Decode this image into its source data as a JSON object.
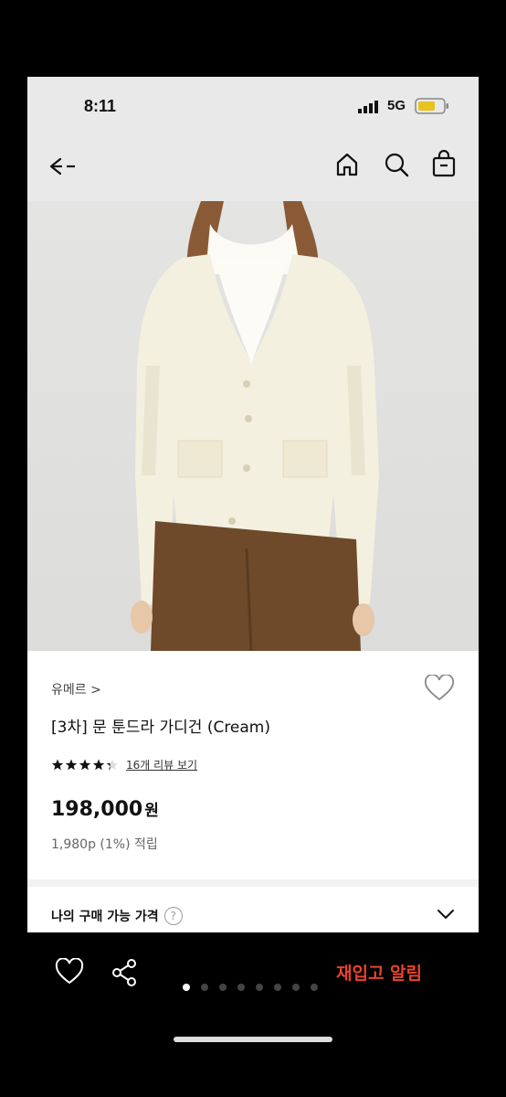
{
  "status": {
    "time": "8:11",
    "network": "5G"
  },
  "nav": {
    "icons": [
      "back-arrow-icon",
      "home-icon",
      "search-icon",
      "shopping-bag-icon"
    ]
  },
  "product": {
    "brand": "유메르 >",
    "title": "[3차] 문 툰드라 가디건 (Cream)",
    "rating": 4.5,
    "review_link": "16개 리뷰 보기",
    "price": "198,000",
    "price_unit": "원",
    "points": "1,980p (1%) 적립"
  },
  "my_price": {
    "label": "나의 구매 가능 가격",
    "help": "?"
  },
  "bottom": {
    "restock_label": "재입고 알림",
    "pages": 8,
    "active_page": 0
  },
  "colors": {
    "accent": "#e8432c",
    "price": "#111111"
  }
}
